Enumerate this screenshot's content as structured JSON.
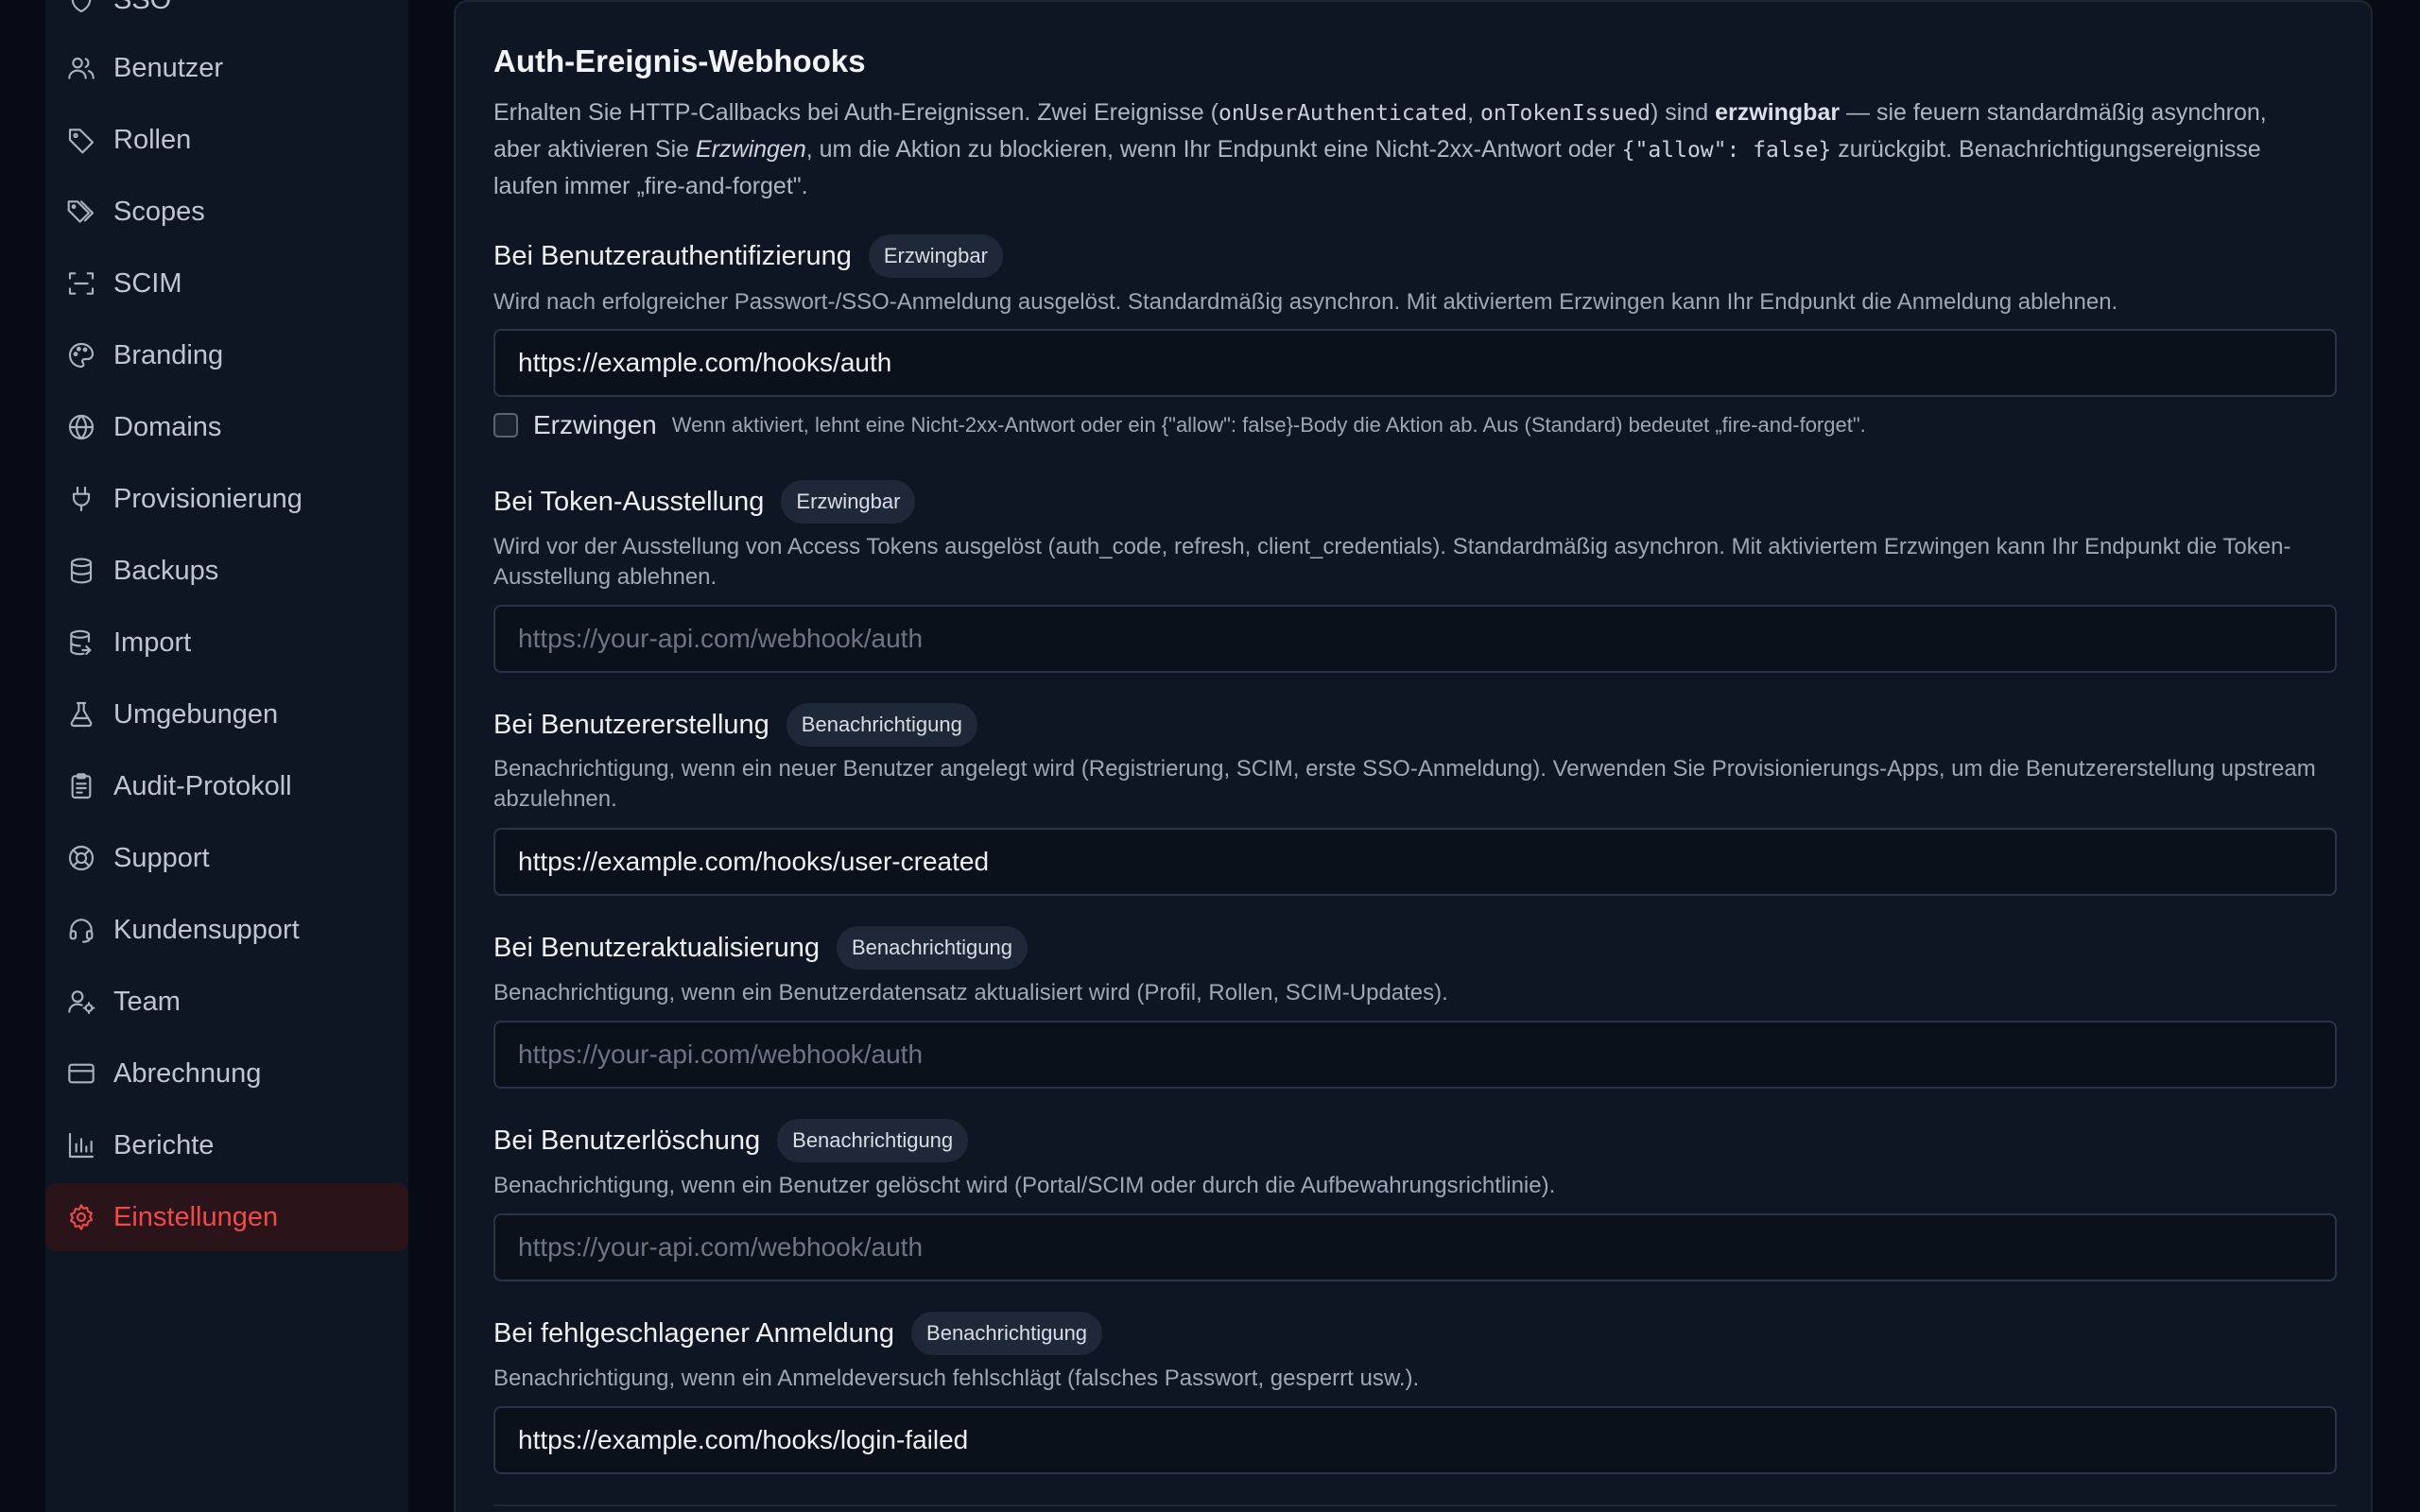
{
  "sidebar": {
    "items": [
      {
        "label": "SSO",
        "icon": "shield-icon"
      },
      {
        "label": "Benutzer",
        "icon": "users-icon"
      },
      {
        "label": "Rollen",
        "icon": "tag-icon"
      },
      {
        "label": "Scopes",
        "icon": "tags-icon"
      },
      {
        "label": "SCIM",
        "icon": "scan-icon"
      },
      {
        "label": "Branding",
        "icon": "palette-icon"
      },
      {
        "label": "Domains",
        "icon": "globe-icon"
      },
      {
        "label": "Provisionierung",
        "icon": "plug-icon"
      },
      {
        "label": "Backups",
        "icon": "database-icon"
      },
      {
        "label": "Import",
        "icon": "database-import-icon"
      },
      {
        "label": "Umgebungen",
        "icon": "flask-icon"
      },
      {
        "label": "Audit-Protokoll",
        "icon": "clipboard-icon"
      },
      {
        "label": "Support",
        "icon": "lifebuoy-icon"
      },
      {
        "label": "Kundensupport",
        "icon": "headset-icon"
      },
      {
        "label": "Team",
        "icon": "user-gear-icon"
      },
      {
        "label": "Abrechnung",
        "icon": "credit-card-icon"
      },
      {
        "label": "Berichte",
        "icon": "bar-chart-icon"
      },
      {
        "label": "Einstellungen",
        "icon": "gear-icon",
        "active": true
      }
    ]
  },
  "webhooks": {
    "title": "Auth-Ereignis-Webhooks",
    "desc": {
      "t1": "Erhalten Sie HTTP-Callbacks bei Auth-Ereignissen. Zwei Ereignisse (",
      "c1": "onUserAuthenticated",
      "t2": ", ",
      "c2": "onTokenIssued",
      "t3": ") sind ",
      "b1": "erzwingbar",
      "t4": " — sie feuern standardmäßig asynchron, aber aktivieren Sie ",
      "i1": "Erzwingen",
      "t5": ", um die Aktion zu blockieren, wenn Ihr Endpunkt eine Nicht-2xx-Antwort oder ",
      "c3": "{\"allow\": false}",
      "t6": " zurückgibt. Benachrichtigungsereignisse laufen immer „fire-and-forget\"."
    },
    "placeholder": "https://your-api.com/webhook/auth",
    "enforce": {
      "label": "Erzwingen",
      "hint": "Wenn aktiviert, lehnt eine Nicht-2xx-Antwort oder ein {\"allow\": false}-Body die Aktion ab. Aus (Standard) bedeutet „fire-and-forget\"."
    },
    "events": [
      {
        "title": "Bei Benutzerauthentifizierung",
        "badge": "Erzwingbar",
        "desc": "Wird nach erfolgreicher Passwort-/SSO-Anmeldung ausgelöst. Standardmäßig asynchron. Mit aktiviertem Erzwingen kann Ihr Endpunkt die Anmeldung ablehnen.",
        "value": "https://example.com/hooks/auth"
      },
      {
        "title": "Bei Token-Ausstellung",
        "badge": "Erzwingbar",
        "desc": "Wird vor der Ausstellung von Access Tokens ausgelöst (auth_code, refresh, client_credentials). Standardmäßig asynchron. Mit aktiviertem Erzwingen kann Ihr Endpunkt die Token-Ausstellung ablehnen.",
        "value": ""
      },
      {
        "title": "Bei Benutzererstellung",
        "badge": "Benachrichtigung",
        "desc": "Benachrichtigung, wenn ein neuer Benutzer angelegt wird (Registrierung, SCIM, erste SSO-Anmeldung). Verwenden Sie Provisionierungs-Apps, um die Benutzererstellung upstream abzulehnen.",
        "value": "https://example.com/hooks/user-created"
      },
      {
        "title": "Bei Benutzeraktualisierung",
        "badge": "Benachrichtigung",
        "desc": "Benachrichtigung, wenn ein Benutzerdatensatz aktualisiert wird (Profil, Rollen, SCIM-Updates).",
        "value": ""
      },
      {
        "title": "Bei Benutzerlöschung",
        "badge": "Benachrichtigung",
        "desc": "Benachrichtigung, wenn ein Benutzer gelöscht wird (Portal/SCIM oder durch die Aufbewahrungsrichtlinie).",
        "value": ""
      },
      {
        "title": "Bei fehlgeschlagener Anmeldung",
        "badge": "Benachrichtigung",
        "desc": "Benachrichtigung, wenn ein Anmeldeversuch fehlschlägt (falsches Passwort, gesperrt usw.).",
        "value": "https://example.com/hooks/login-failed"
      }
    ]
  },
  "colors": {
    "accent": "#ef4a4a",
    "background": "#070b13",
    "panel": "#0f1623"
  }
}
